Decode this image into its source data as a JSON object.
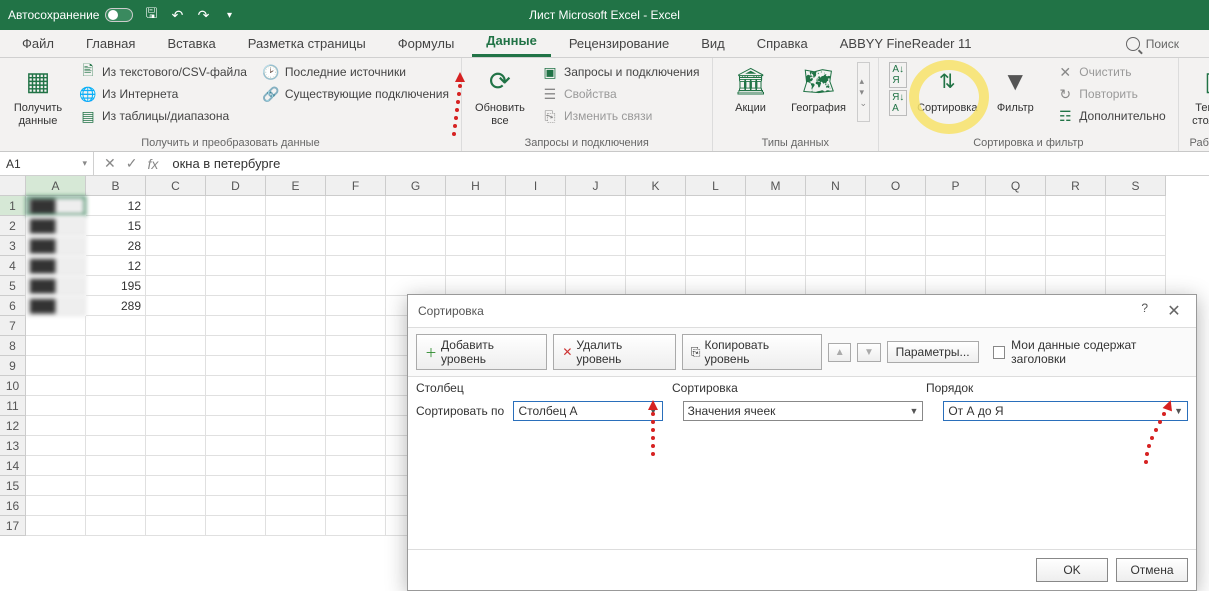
{
  "titlebar": {
    "autosave": "Автосохранение",
    "title": "Лист Microsoft Excel  -  Excel"
  },
  "tabs": {
    "file": "Файл",
    "home": "Главная",
    "insert": "Вставка",
    "layout": "Разметка страницы",
    "formulas": "Формулы",
    "data": "Данные",
    "review": "Рецензирование",
    "view": "Вид",
    "help": "Справка",
    "abbyy": "ABBYY FineReader 11",
    "search": "Поиск"
  },
  "ribbon": {
    "get_data": {
      "label": "Получить\nданные",
      "txt_csv": "Из текстового/CSV-файла",
      "internet": "Из Интернета",
      "table": "Из таблицы/диапазона",
      "recent": "Последние источники",
      "existing": "Существующие подключения",
      "group": "Получить и преобразовать данные"
    },
    "refresh": {
      "label": "Обновить\nвсе",
      "queries": "Запросы и подключения",
      "props": "Свойства",
      "links": "Изменить связи",
      "group": "Запросы и подключения"
    },
    "types": {
      "stocks": "Акции",
      "geo": "География",
      "group": "Типы данных"
    },
    "sort": {
      "sort": "Сортировка",
      "filter": "Фильтр",
      "clear": "Очистить",
      "reapply": "Повторить",
      "advanced": "Дополнительно",
      "group": "Сортировка и фильтр"
    },
    "text": {
      "label": "Текст по\nстолбцам",
      "group": "Работа с д"
    }
  },
  "formula_bar": {
    "cell": "A1",
    "value": "окна в петербурге"
  },
  "columns": [
    "A",
    "B",
    "C",
    "D",
    "E",
    "F",
    "G",
    "H",
    "I",
    "J",
    "K",
    "L",
    "M",
    "N",
    "O",
    "P",
    "Q",
    "R",
    "S"
  ],
  "rows": [
    "1",
    "2",
    "3",
    "4",
    "5",
    "6",
    "7",
    "8",
    "9",
    "10",
    "11",
    "12",
    "13",
    "14",
    "15",
    "16",
    "17"
  ],
  "data_b": [
    "12",
    "15",
    "28",
    "12",
    "195",
    "289"
  ],
  "dialog": {
    "title": "Сортировка",
    "add": "Добавить уровень",
    "del": "Удалить уровень",
    "copy": "Копировать уровень",
    "opts": "Параметры...",
    "headers": "Мои данные содержат заголовки",
    "col_hdr": "Столбец",
    "sort_hdr": "Сортировка",
    "order_hdr": "Порядок",
    "sort_by": "Сортировать по",
    "col_val": "Столбец A",
    "sort_val": "Значения ячеек",
    "order_val": "От А до Я",
    "ok": "OK",
    "cancel": "Отмена",
    "help": "?"
  }
}
